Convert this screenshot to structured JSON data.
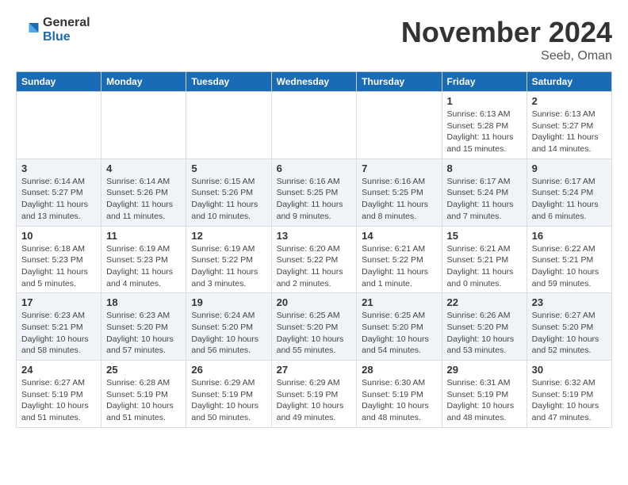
{
  "logo": {
    "general": "General",
    "blue": "Blue"
  },
  "title": "November 2024",
  "location": "Seeb, Oman",
  "days_header": [
    "Sunday",
    "Monday",
    "Tuesday",
    "Wednesday",
    "Thursday",
    "Friday",
    "Saturday"
  ],
  "weeks": [
    {
      "days": [
        {
          "num": "",
          "info": ""
        },
        {
          "num": "",
          "info": ""
        },
        {
          "num": "",
          "info": ""
        },
        {
          "num": "",
          "info": ""
        },
        {
          "num": "",
          "info": ""
        },
        {
          "num": "1",
          "info": "Sunrise: 6:13 AM\nSunset: 5:28 PM\nDaylight: 11 hours\nand 15 minutes."
        },
        {
          "num": "2",
          "info": "Sunrise: 6:13 AM\nSunset: 5:27 PM\nDaylight: 11 hours\nand 14 minutes."
        }
      ]
    },
    {
      "days": [
        {
          "num": "3",
          "info": "Sunrise: 6:14 AM\nSunset: 5:27 PM\nDaylight: 11 hours\nand 13 minutes."
        },
        {
          "num": "4",
          "info": "Sunrise: 6:14 AM\nSunset: 5:26 PM\nDaylight: 11 hours\nand 11 minutes."
        },
        {
          "num": "5",
          "info": "Sunrise: 6:15 AM\nSunset: 5:26 PM\nDaylight: 11 hours\nand 10 minutes."
        },
        {
          "num": "6",
          "info": "Sunrise: 6:16 AM\nSunset: 5:25 PM\nDaylight: 11 hours\nand 9 minutes."
        },
        {
          "num": "7",
          "info": "Sunrise: 6:16 AM\nSunset: 5:25 PM\nDaylight: 11 hours\nand 8 minutes."
        },
        {
          "num": "8",
          "info": "Sunrise: 6:17 AM\nSunset: 5:24 PM\nDaylight: 11 hours\nand 7 minutes."
        },
        {
          "num": "9",
          "info": "Sunrise: 6:17 AM\nSunset: 5:24 PM\nDaylight: 11 hours\nand 6 minutes."
        }
      ]
    },
    {
      "days": [
        {
          "num": "10",
          "info": "Sunrise: 6:18 AM\nSunset: 5:23 PM\nDaylight: 11 hours\nand 5 minutes."
        },
        {
          "num": "11",
          "info": "Sunrise: 6:19 AM\nSunset: 5:23 PM\nDaylight: 11 hours\nand 4 minutes."
        },
        {
          "num": "12",
          "info": "Sunrise: 6:19 AM\nSunset: 5:22 PM\nDaylight: 11 hours\nand 3 minutes."
        },
        {
          "num": "13",
          "info": "Sunrise: 6:20 AM\nSunset: 5:22 PM\nDaylight: 11 hours\nand 2 minutes."
        },
        {
          "num": "14",
          "info": "Sunrise: 6:21 AM\nSunset: 5:22 PM\nDaylight: 11 hours\nand 1 minute."
        },
        {
          "num": "15",
          "info": "Sunrise: 6:21 AM\nSunset: 5:21 PM\nDaylight: 11 hours\nand 0 minutes."
        },
        {
          "num": "16",
          "info": "Sunrise: 6:22 AM\nSunset: 5:21 PM\nDaylight: 10 hours\nand 59 minutes."
        }
      ]
    },
    {
      "days": [
        {
          "num": "17",
          "info": "Sunrise: 6:23 AM\nSunset: 5:21 PM\nDaylight: 10 hours\nand 58 minutes."
        },
        {
          "num": "18",
          "info": "Sunrise: 6:23 AM\nSunset: 5:20 PM\nDaylight: 10 hours\nand 57 minutes."
        },
        {
          "num": "19",
          "info": "Sunrise: 6:24 AM\nSunset: 5:20 PM\nDaylight: 10 hours\nand 56 minutes."
        },
        {
          "num": "20",
          "info": "Sunrise: 6:25 AM\nSunset: 5:20 PM\nDaylight: 10 hours\nand 55 minutes."
        },
        {
          "num": "21",
          "info": "Sunrise: 6:25 AM\nSunset: 5:20 PM\nDaylight: 10 hours\nand 54 minutes."
        },
        {
          "num": "22",
          "info": "Sunrise: 6:26 AM\nSunset: 5:20 PM\nDaylight: 10 hours\nand 53 minutes."
        },
        {
          "num": "23",
          "info": "Sunrise: 6:27 AM\nSunset: 5:20 PM\nDaylight: 10 hours\nand 52 minutes."
        }
      ]
    },
    {
      "days": [
        {
          "num": "24",
          "info": "Sunrise: 6:27 AM\nSunset: 5:19 PM\nDaylight: 10 hours\nand 51 minutes."
        },
        {
          "num": "25",
          "info": "Sunrise: 6:28 AM\nSunset: 5:19 PM\nDaylight: 10 hours\nand 51 minutes."
        },
        {
          "num": "26",
          "info": "Sunrise: 6:29 AM\nSunset: 5:19 PM\nDaylight: 10 hours\nand 50 minutes."
        },
        {
          "num": "27",
          "info": "Sunrise: 6:29 AM\nSunset: 5:19 PM\nDaylight: 10 hours\nand 49 minutes."
        },
        {
          "num": "28",
          "info": "Sunrise: 6:30 AM\nSunset: 5:19 PM\nDaylight: 10 hours\nand 48 minutes."
        },
        {
          "num": "29",
          "info": "Sunrise: 6:31 AM\nSunset: 5:19 PM\nDaylight: 10 hours\nand 48 minutes."
        },
        {
          "num": "30",
          "info": "Sunrise: 6:32 AM\nSunset: 5:19 PM\nDaylight: 10 hours\nand 47 minutes."
        }
      ]
    }
  ]
}
